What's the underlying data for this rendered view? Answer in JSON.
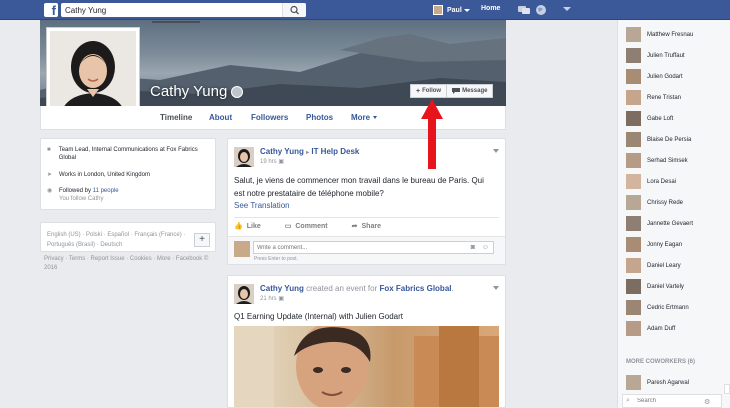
{
  "topbar": {
    "logo": "f",
    "search_value": "Cathy Yung",
    "user": "Paul",
    "home": "Home",
    "icons": [
      "friends-icon",
      "messages-icon",
      "globe-icon",
      "account-menu-icon"
    ]
  },
  "profile": {
    "name": "Cathy Yung",
    "follow_label": "Follow",
    "message_label": "Message"
  },
  "nav": {
    "tabs": [
      "Timeline",
      "About",
      "Followers",
      "Photos",
      "More"
    ],
    "active": "Timeline"
  },
  "intro": {
    "job": "Team Lead, Internal Communications at Fox Fabrics Global",
    "location": "Works in London, United Kingdom",
    "followed_prefix": "Followed by ",
    "followed_link": "11 people",
    "you_follow": "You follow Cathy"
  },
  "languages": {
    "text": "English (US) · Polski · Español · Français (France) · Português (Brasil) · Deutsch",
    "plus": "+"
  },
  "footer": {
    "text": "Privacy · Terms · Report Issue · Cookies · More · Facebook © 2016"
  },
  "posts": [
    {
      "author": "Cathy Yung",
      "separator": "▸",
      "target": "IT Help Desk",
      "time": "19 hrs",
      "text": "Salut, je viens de commencer mon travail dans le bureau de Paris. Qui est notre prestataire de téléphone mobile?",
      "see_translation": "See Translation",
      "actions": [
        "Like",
        "Comment",
        "Share"
      ],
      "comment_placeholder": "Write a comment...",
      "comment_hint": "Press Enter to post."
    },
    {
      "author": "Cathy Yung",
      "action_text": " created an event for ",
      "target": "Fox Fabrics Global",
      "target_suffix": ".",
      "time": "21 hrs",
      "text": "Q1 Earning Update (Internal) with Julien Godart"
    }
  ],
  "chat": {
    "contacts": [
      "Matthew Fresnau",
      "Julien Truffaut",
      "Julien Godart",
      "Rene Tristan",
      "Gabe Loft",
      "Blaise De Persia",
      "Serhad Simsek",
      "Lora Desai",
      "Chrissy Rede",
      "Jannette Gevaert",
      "Jonny Eagan",
      "Daniel Leary",
      "Daniel Vartely",
      "Cedric Ertmann",
      "Adam Duff"
    ],
    "more_coworkers": "MORE COWORKERS (6)",
    "extra_contact": "Paresh Agarwal",
    "search_placeholder": "Search"
  },
  "colors": {
    "brand": "#3b5998",
    "link": "#365899",
    "annotation_arrow": "#e8141b"
  }
}
